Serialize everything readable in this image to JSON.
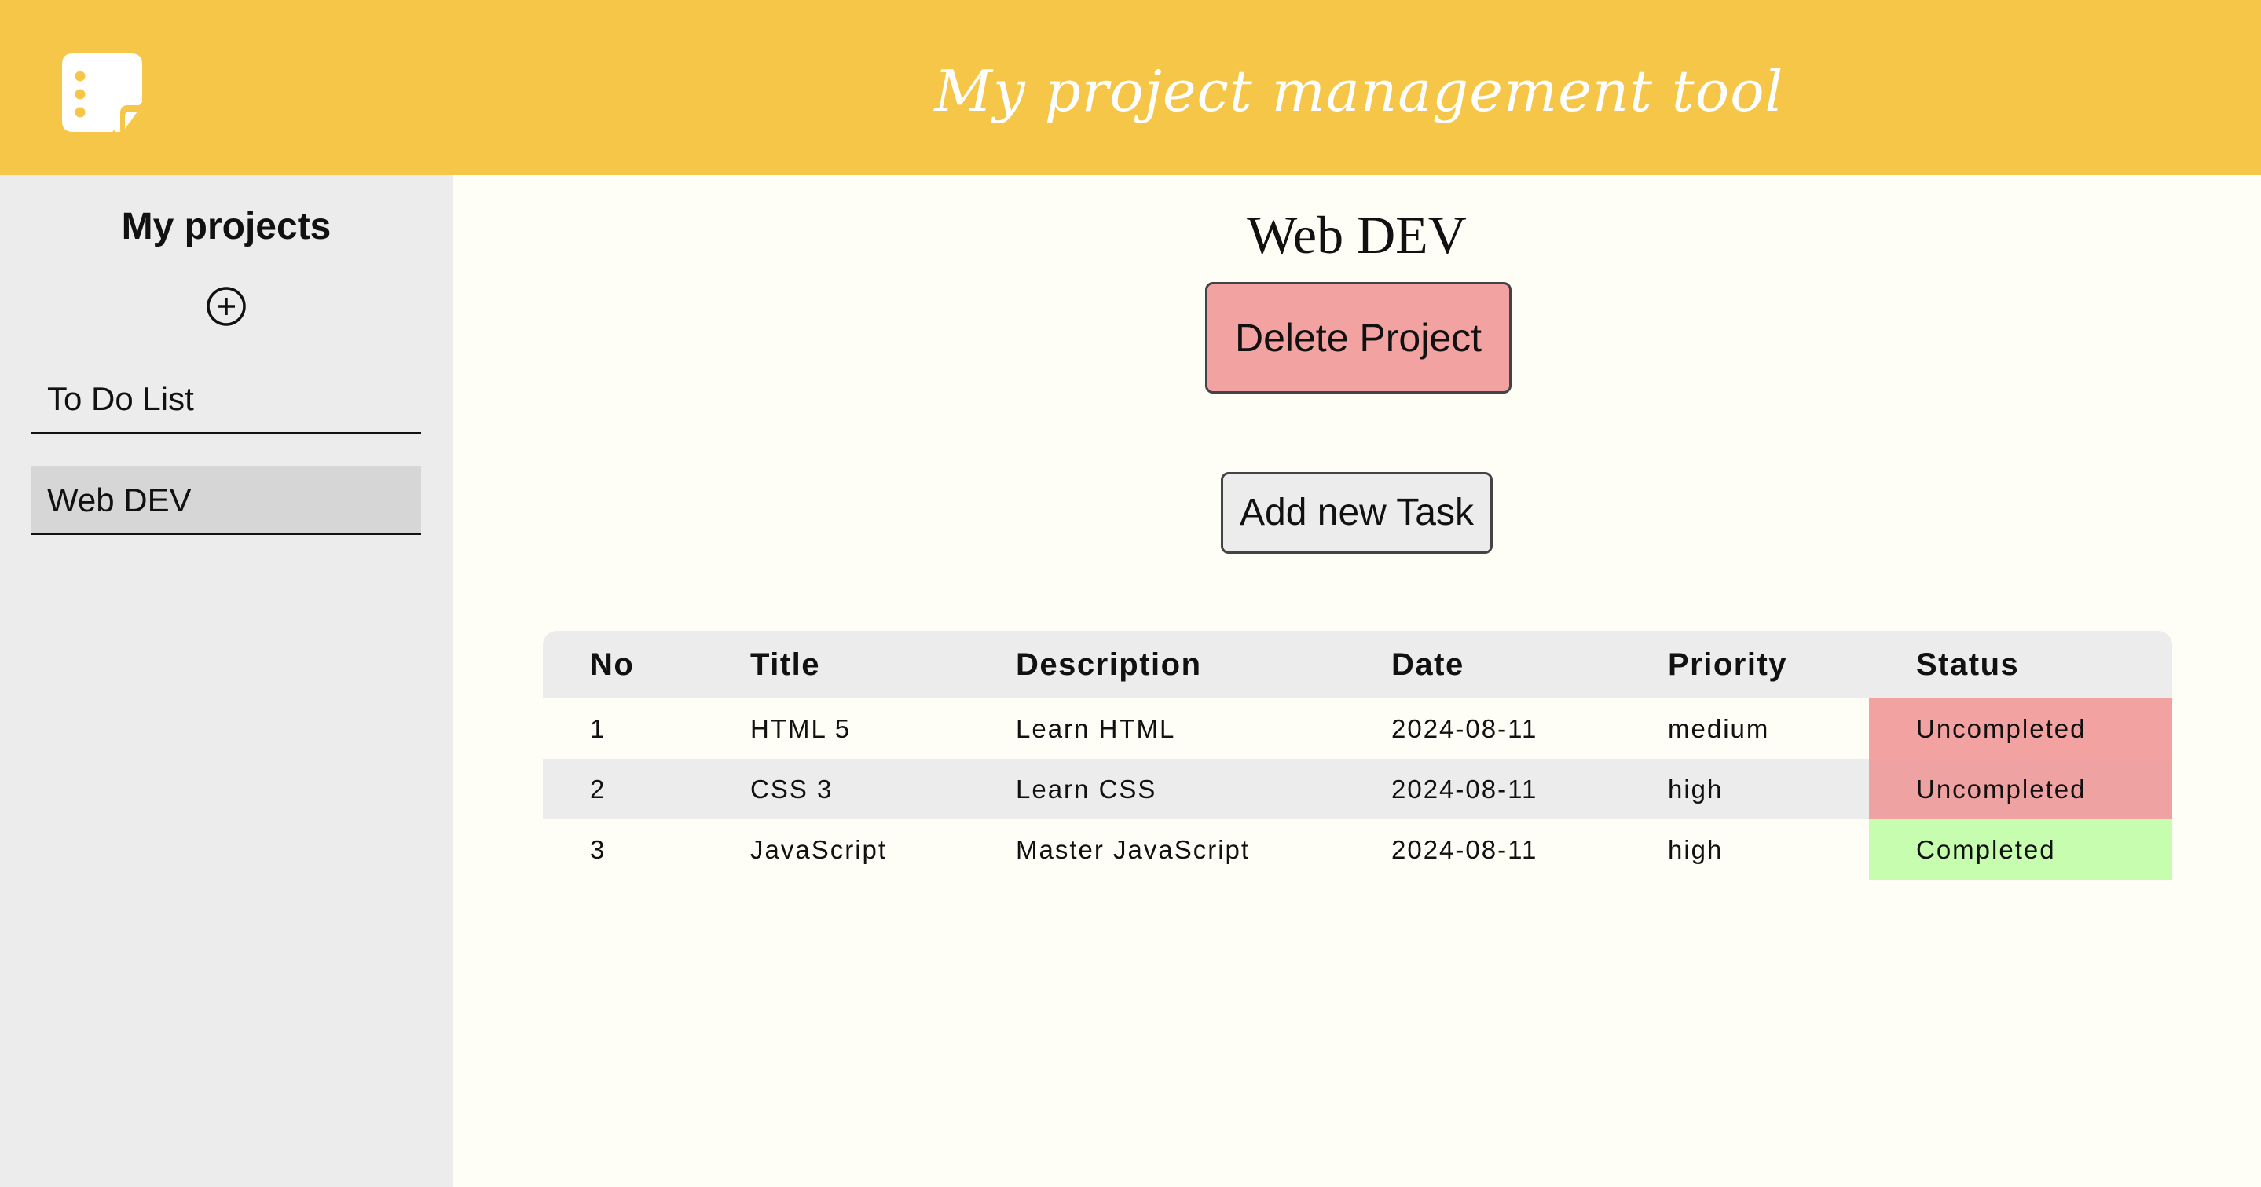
{
  "header": {
    "title": "My project management tool",
    "logo_icon": "sticky-note-icon",
    "background_color": "#f5c647"
  },
  "sidebar": {
    "title": "My projects",
    "add_icon": "plus-circle-icon",
    "projects": [
      {
        "label": "To Do List",
        "active": false
      },
      {
        "label": "Web DEV",
        "active": true
      }
    ]
  },
  "main": {
    "project_title": "Web DEV",
    "delete_button_label": "Delete Project",
    "add_task_button_label": "Add new Task",
    "table": {
      "headers": [
        "No",
        "Title",
        "Description",
        "Date",
        "Priority",
        "Status"
      ],
      "rows": [
        {
          "no": "1",
          "title": "HTML 5",
          "description": "Learn HTML",
          "date": "2024-08-11",
          "priority": "medium",
          "status": "Uncompleted"
        },
        {
          "no": "2",
          "title": "CSS 3",
          "description": "Learn CSS",
          "date": "2024-08-11",
          "priority": "high",
          "status": "Uncompleted"
        },
        {
          "no": "3",
          "title": "JavaScript",
          "description": "Master JavaScript",
          "date": "2024-08-11",
          "priority": "high",
          "status": "Completed"
        }
      ]
    }
  },
  "colors": {
    "accent": "#f5c647",
    "uncompleted": "#f3a2a2",
    "completed": "#c6fdae",
    "delete_button": "#f3a2a2"
  }
}
